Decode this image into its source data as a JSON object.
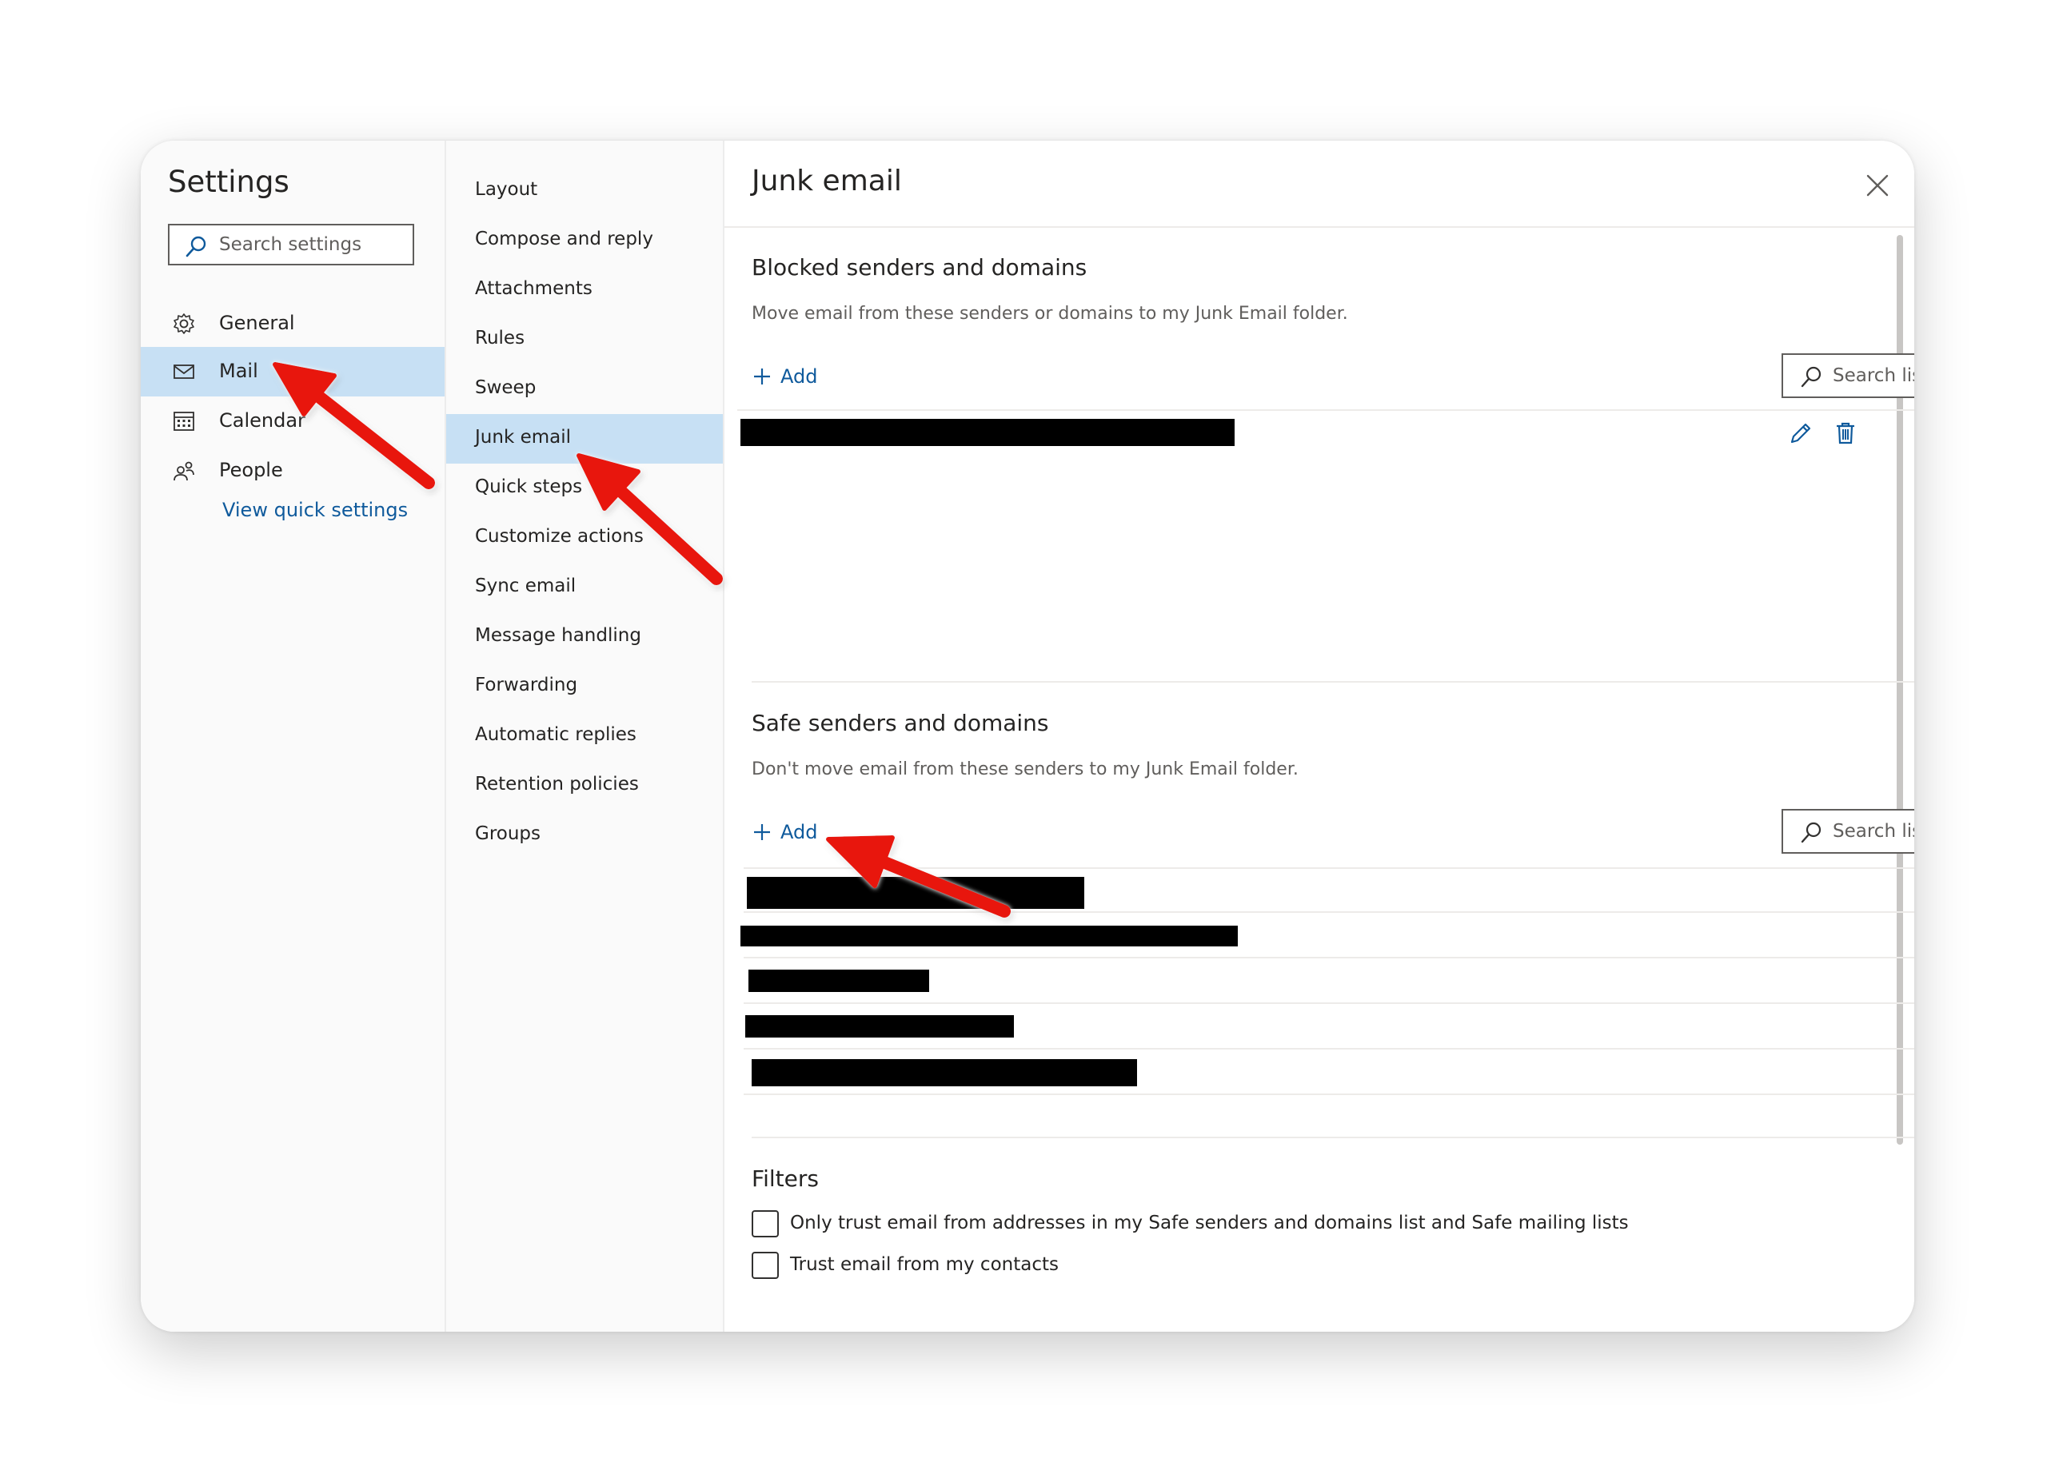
{
  "sidebar": {
    "title": "Settings",
    "search_placeholder": "Search settings",
    "items": [
      {
        "label": "General",
        "icon": "gear-icon"
      },
      {
        "label": "Mail",
        "icon": "mail-icon",
        "selected": true
      },
      {
        "label": "Calendar",
        "icon": "calendar-icon"
      },
      {
        "label": "People",
        "icon": "people-icon"
      }
    ],
    "quick_settings_link": "View quick settings"
  },
  "submenu": {
    "items": [
      {
        "label": "Layout"
      },
      {
        "label": "Compose and reply"
      },
      {
        "label": "Attachments"
      },
      {
        "label": "Rules"
      },
      {
        "label": "Sweep"
      },
      {
        "label": "Junk email",
        "selected": true
      },
      {
        "label": "Quick steps"
      },
      {
        "label": "Customize actions"
      },
      {
        "label": "Sync email"
      },
      {
        "label": "Message handling"
      },
      {
        "label": "Forwarding"
      },
      {
        "label": "Automatic replies"
      },
      {
        "label": "Retention policies"
      },
      {
        "label": "Groups"
      }
    ]
  },
  "content": {
    "title": "Junk email",
    "blocked": {
      "title": "Blocked senders and domains",
      "description": "Move email from these senders or domains to my Junk Email folder.",
      "add_label": "Add",
      "search_placeholder": "Search list",
      "entries_redacted": 1
    },
    "safe": {
      "title": "Safe senders and domains",
      "description": "Don't move email from these senders to my Junk Email folder.",
      "add_label": "Add",
      "search_placeholder": "Search list",
      "entries_redacted": 5
    },
    "filters": {
      "title": "Filters",
      "options": [
        {
          "label": "Only trust email from addresses in my Safe senders and domains list and Safe mailing lists",
          "checked": false
        },
        {
          "label": "Trust email from my contacts",
          "checked": false
        }
      ]
    }
  },
  "colors": {
    "accent": "#0f5a9c",
    "selected_bg": "#c7e0f4",
    "annotation_arrow": "#e8140e"
  }
}
